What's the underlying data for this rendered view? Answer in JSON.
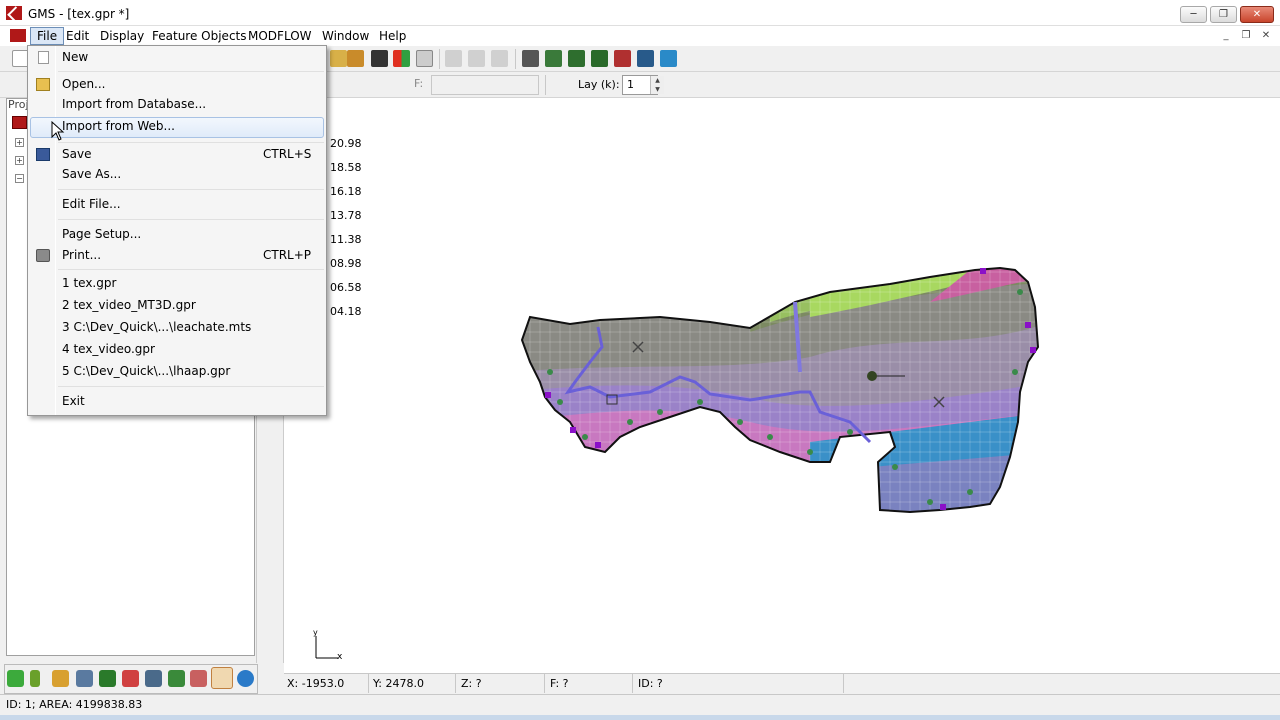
{
  "window": {
    "title": "GMS - [tex.gpr *]",
    "buttons": {
      "minimize": "─",
      "restore": "❐",
      "close": "✕"
    }
  },
  "menubar": {
    "items": [
      "File",
      "Edit",
      "Display",
      "Feature Objects",
      "MODFLOW",
      "Window",
      "Help"
    ],
    "mdi_buttons": [
      "_",
      "❐",
      "✕"
    ]
  },
  "toolbar2": {
    "f_label": "F:",
    "lay_label": "Lay (k):",
    "lay_value": "1"
  },
  "explorer": {
    "label": "Proj"
  },
  "legend": {
    "values": [
      "20.98",
      "18.58",
      "16.18",
      "13.78",
      "11.38",
      "08.98",
      "06.58",
      "04.18"
    ]
  },
  "axis_triad": {
    "y": "y",
    "x": "x"
  },
  "status": {
    "x": "X: -1953.0",
    "y": "Y: 2478.0",
    "z": "Z: ?",
    "f": "F: ?",
    "id": "ID: ?",
    "bottom": "ID: 1; AREA: 4199838.83"
  },
  "file_menu": {
    "new": "New",
    "open": "Open...",
    "import_db": "Import from Database...",
    "import_web": "Import from Web...",
    "save": "Save",
    "save_shortcut": "CTRL+S",
    "save_as": "Save As...",
    "edit_file": "Edit File...",
    "page_setup": "Page Setup...",
    "print": "Print...",
    "print_shortcut": "CTRL+P",
    "recent": [
      "1 tex.gpr",
      "2 tex_video_MT3D.gpr",
      "3 C:\\Dev_Quick\\...\\leachate.mts",
      "4 tex_video.gpr",
      "5 C:\\Dev_Quick\\...\\lhaap.gpr"
    ],
    "exit": "Exit"
  },
  "colors": {
    "accent": "#b01818",
    "menu_highlight": "#dbe7f6"
  }
}
